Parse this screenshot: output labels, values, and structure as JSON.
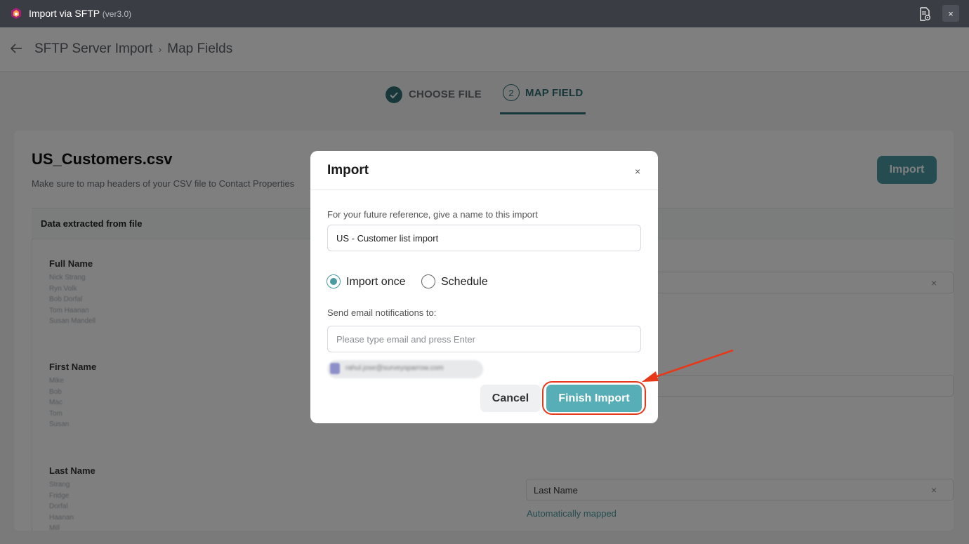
{
  "window": {
    "title": "Import via SFTP",
    "version": "(ver3.0)",
    "close_label": "×"
  },
  "header": {
    "breadcrumb_root": "SFTP Server Import",
    "breadcrumb_sep": "›",
    "breadcrumb_current": "Map Fields"
  },
  "stepper": {
    "step1_label": "CHOOSE FILE",
    "step2_number": "2",
    "step2_label": "MAP FIELD"
  },
  "main": {
    "file_title": "US_Customers.csv",
    "file_subtitle": "Make sure to map headers of your CSV file to Contact Properties",
    "import_button": "Import",
    "table_header": "Data extracted from file",
    "fields": [
      {
        "name": "Full Name",
        "samples": [
          "Nick Strang",
          "Ryn Volk",
          "Bob Dorfal",
          "Tom Haanan",
          "Susan Mandell"
        ]
      },
      {
        "name": "First Name",
        "samples": [
          "Mike",
          "Bob",
          "Mac",
          "Tom",
          "Susan"
        ]
      },
      {
        "name": "Last Name",
        "samples": [
          "Strang",
          "Fridge",
          "Dorfal",
          "Haanan",
          "Mill"
        ]
      }
    ],
    "mapped_last_name": "Last Name",
    "clear_icon": "×",
    "auto_mapped": "Automatically mapped"
  },
  "modal": {
    "title": "Import",
    "close": "×",
    "name_label": "For your future reference, give a name to this import",
    "name_value": "US - Customer list import",
    "radio_once": "Import once",
    "radio_schedule": "Schedule",
    "email_label": "Send email notifications to:",
    "email_placeholder": "Please type email and press Enter",
    "email_chip": "rahul.jose@surveysparrow.com",
    "cancel": "Cancel",
    "finish": "Finish Import"
  },
  "colors": {
    "accent": "#4a9aa2",
    "finish": "#58aeb6",
    "annotation": "#e8381a"
  }
}
